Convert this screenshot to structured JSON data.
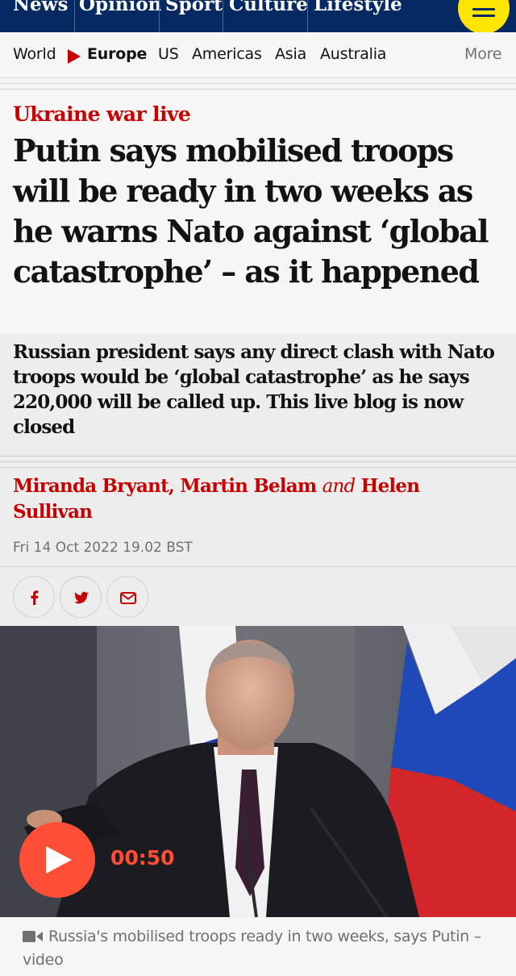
{
  "top_nav": {
    "pillars": [
      "News",
      "Opinion",
      "Sport",
      "Culture",
      "Lifestyle"
    ],
    "menu_icon": "hamburger-icon",
    "colors": {
      "background": "#052962",
      "menu_button": "#ffe500"
    }
  },
  "section_nav": {
    "items": [
      "World",
      "Europe",
      "US",
      "Americas",
      "Asia",
      "Australia"
    ],
    "active": "Europe",
    "more_label": "More"
  },
  "article": {
    "kicker": "Ukraine war live",
    "headline": "Putin says mobilised troops will be ready in two weeks as he warns Nato against ‘global catastrophe’ – as it happened",
    "standfirst": "Russian president says any direct clash with Nato troops would be ‘global catastrophe’ as he says 220,000 will be called up. This live blog is now closed",
    "byline": {
      "author1": "Miranda Bryant,",
      "author2": "Martin Belam",
      "and": "and",
      "author3": "Helen Sullivan"
    },
    "date": "Fri 14 Oct 2022 19.02 BST",
    "colors": {
      "accent": "#c70000",
      "play": "#ff4e36"
    }
  },
  "share": {
    "icons": [
      "facebook-icon",
      "twitter-icon",
      "email-icon"
    ]
  },
  "media": {
    "duration": "00:50",
    "caption": "Russia's mobilised troops ready in two weeks, says Putin – video",
    "caption_icon": "video-camera-icon"
  }
}
